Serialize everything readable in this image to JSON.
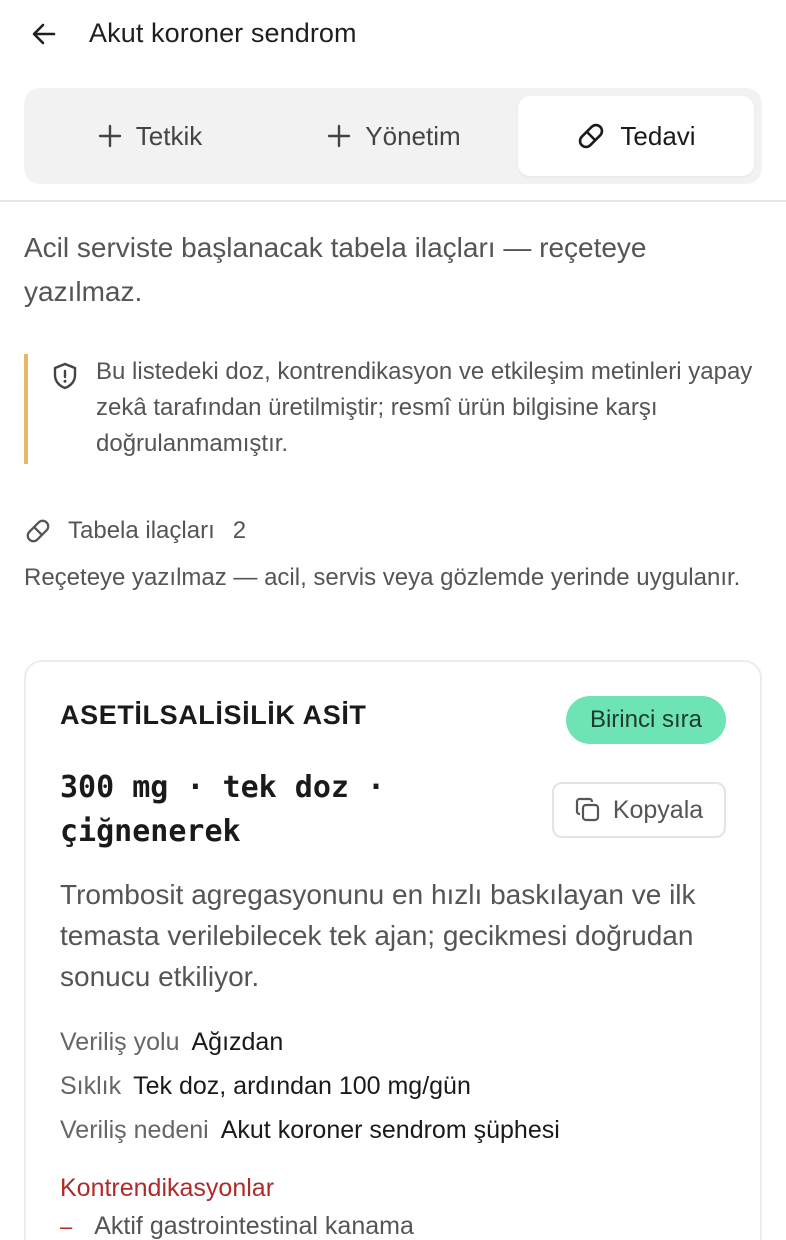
{
  "header": {
    "title": "Akut koroner sendrom",
    "back_icon": "arrow-left-icon"
  },
  "tabs": [
    {
      "label": "Tetkik",
      "icon": "plus-icon",
      "active": false
    },
    {
      "label": "Yönetim",
      "icon": "plus-icon",
      "active": false
    },
    {
      "label": "Tedavi",
      "icon": "pill-icon",
      "active": true
    }
  ],
  "intro": "Acil serviste başlanacak tabela ilaçları — reçeteye yazılmaz.",
  "warning": {
    "icon": "shield-alert-icon",
    "text": "Bu listedeki doz, kontrendikasyon ve etkileşim metinleri yapay zekâ tarafından üretilmiştir; resmî ürün bilgisine karşı doğrulanmamıştır.",
    "accent_color": "#e6b968"
  },
  "section": {
    "icon": "pill-icon",
    "title": "Tabela ilaçları",
    "count": "2",
    "description": "Reçeteye yazılmaz — acil, servis veya gözlemde yerinde uygulanır."
  },
  "drug": {
    "name": "ASETİLSALİSİLİK ASİT",
    "badge": "Birinci sıra",
    "badge_color": "#6ee3b4",
    "dose": "300 mg · tek doz · çiğnenerek",
    "copy_label": "Kopyala",
    "copy_icon": "copy-icon",
    "description": "Trombosit agregasyonunu en hızlı baskılayan ve ilk temasta verilebilecek tek ajan; gecikmesi doğrudan sonucu etkiliyor.",
    "properties": [
      {
        "label": "Veriliş yolu",
        "value": "Ağızdan"
      },
      {
        "label": "Sıklık",
        "value": "Tek doz, ardından 100 mg/gün"
      },
      {
        "label": "Veriliş nedeni",
        "value": "Akut koroner sendrom şüphesi"
      }
    ],
    "contraindications_title": "Kontrendikasyonlar",
    "contraindications_color": "#b02a2a",
    "contraindications": [
      "Aktif gastrointestinal kanama"
    ]
  }
}
